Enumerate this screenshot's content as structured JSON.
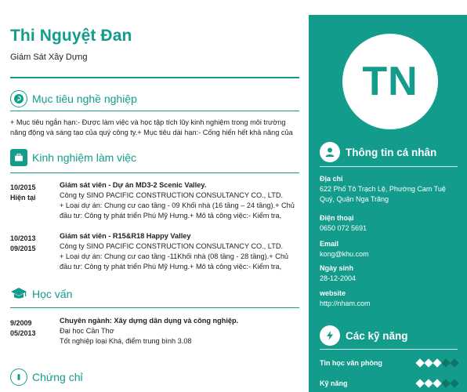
{
  "profile": {
    "name": "Thi Nguyệt Đan",
    "role": "Giám Sát Xây Dựng",
    "initials": "TN"
  },
  "objective": {
    "title": "Mục tiêu nghề nghiệp",
    "lines": [
      "+ Mục tiêu ngắn hạn:- Được làm việc và học tập tích lũy kinh nghiệm trong môi trường",
      "năng động và sáng tạo của quý công ty.+ Mục tiêu dài hạn:- Cống hiến hết khả năng của"
    ]
  },
  "experience": {
    "title": "Kinh nghiệm làm việc",
    "items": [
      {
        "date_from": "10/2015",
        "date_to": "Hiện tại",
        "title": "Giám sát viên - Dự án MD3-2 Scenic Valley.",
        "company": "Công ty SINO PACIFIC CONSTRUCTION CONSULTANCY CO., LTD.",
        "line1": "+ Loại dự án: Chung cư cao tầng - 09 Khối nhà (16 tầng – 24 tầng).+ Chủ",
        "line2": "đầu tư: Công ty phát triển Phú Mỹ Hưng.+ Mô tả công việc:- Kiểm tra,"
      },
      {
        "date_from": "10/2013",
        "date_to": "09/2015",
        "title": "Giám sát viên - R15&R18 Happy Valley",
        "company": "Công ty SINO PACIFIC CONSTRUCTION CONSULTANCY CO., LTD.",
        "line1": "+ Loại dự án: Chung cư cao tầng -11Khối nhà (08 tầng - 28 tầng).+ Chủ",
        "line2": "đầu tư: Công ty phát triển Phú Mỹ Hưng.+ Mô tả công việc:- Kiểm tra,"
      }
    ]
  },
  "education": {
    "title": "Học vấn",
    "items": [
      {
        "date_from": "9/2009",
        "date_to": "05/2013",
        "title": "Chuyên ngành: Xây dựng dân dụng và công nghiệp.",
        "school": "Đại học Cần Thơ",
        "note": "Tốt nghiệp loại Khá, điểm trung bình 3.08"
      }
    ]
  },
  "certificates": {
    "title": "Chứng chỉ"
  },
  "personal": {
    "title": "Thông tin cá nhân",
    "address_label": "Địa chỉ",
    "address_value": "622 Phố Tô Trạch Lệ, Phường Cam Tuệ Quý, Quận Nga Trăng",
    "phone_label": "Điện thoại",
    "phone_value": "0650 072 5691",
    "email_label": "Email",
    "email_value": "kong@khu.com",
    "birth_label": "Ngày sinh",
    "birth_value": "28-12-2004",
    "website_label": "website",
    "website_value": "http://nham.com"
  },
  "skills": {
    "title": "Các kỹ năng",
    "items": [
      {
        "name": "Tin học văn phòng",
        "level": 3,
        "max": 5
      },
      {
        "name": "Kỹ năng",
        "level": 3,
        "max": 5
      }
    ]
  },
  "colors": {
    "accent": "#139c8c",
    "sidebar": "#139c8c",
    "text": "#222222"
  }
}
